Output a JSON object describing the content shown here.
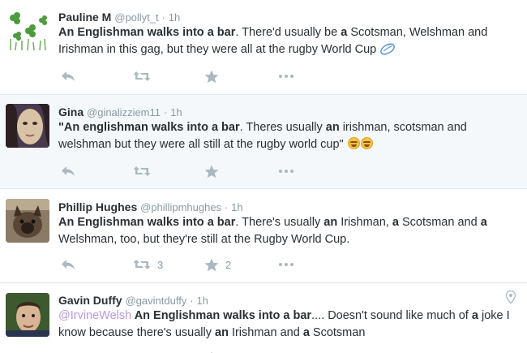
{
  "tweets": [
    {
      "name": "Pauline M",
      "handle": "@pollyt_t",
      "dot": "·",
      "time": "1h",
      "avatar": "shamrock-avatar",
      "segments": [
        {
          "t": "An Englishman walks into a bar",
          "b": true
        },
        {
          "t": ". There'd usually be ",
          "b": false
        },
        {
          "t": "a",
          "b": true
        },
        {
          "t": " Scotsman, Welshman and Irishman in this gag, but they were all at the rugby World Cup ",
          "b": false
        }
      ],
      "emoji": "rugby-ball-emoji",
      "retweets": "",
      "likes": ""
    },
    {
      "name": "Gina",
      "handle": "@ginalizziem11",
      "dot": "·",
      "time": "1h",
      "avatar": "photo-avatar",
      "segments": [
        {
          "t": "\"An englishman walks into a bar",
          "b": true
        },
        {
          "t": ". Theres usually ",
          "b": false
        },
        {
          "t": "an",
          "b": true
        },
        {
          "t": " irishman, scotsman and welshman but they were all still at the rugby world cup\" ",
          "b": false
        }
      ],
      "emoji": "tears-of-joy-emoji",
      "retweets": "",
      "likes": ""
    },
    {
      "name": "Phillip Hughes",
      "handle": "@phillipmhughes",
      "dot": "·",
      "time": "1h",
      "avatar": "dog-avatar",
      "segments": [
        {
          "t": "An Englishman walks into a bar",
          "b": true
        },
        {
          "t": ". There's usually ",
          "b": false
        },
        {
          "t": "an",
          "b": true
        },
        {
          "t": " Irishman, ",
          "b": false
        },
        {
          "t": "a",
          "b": true
        },
        {
          "t": " Scotsman and ",
          "b": false
        },
        {
          "t": "a",
          "b": true
        },
        {
          "t": " Welshman, too, but they're still at the Rugby World Cup.",
          "b": false
        }
      ],
      "emoji": "",
      "retweets": "3",
      "likes": "2"
    },
    {
      "name": "Gavin Duffy",
      "handle": "@gavintduffy",
      "dot": "·",
      "time": "1h",
      "avatar": "man-avatar",
      "mention": "@IrvineWelsh",
      "segments": [
        {
          "t": " An Englishman walks into a bar",
          "b": true
        },
        {
          "t": ".... Doesn't sound like much of ",
          "b": false
        },
        {
          "t": "a",
          "b": true
        },
        {
          "t": " joke I know because there's usually ",
          "b": false
        },
        {
          "t": "an",
          "b": true
        },
        {
          "t": " Irishman and ",
          "b": false
        },
        {
          "t": "a",
          "b": true
        },
        {
          "t": " Scotsman",
          "b": false
        }
      ],
      "emoji": "",
      "retweets": "",
      "likes": ""
    }
  ],
  "colors": {
    "text": "#292f33",
    "muted": "#8899a6",
    "icon": "#aab8c2",
    "mention": "#b89ae0",
    "highlight_bg": "#f5f8fa",
    "divider": "#e1e8ed"
  },
  "icons": [
    "reply-icon",
    "retweet-icon",
    "like-star-icon",
    "more-icon",
    "location-pin-icon"
  ]
}
